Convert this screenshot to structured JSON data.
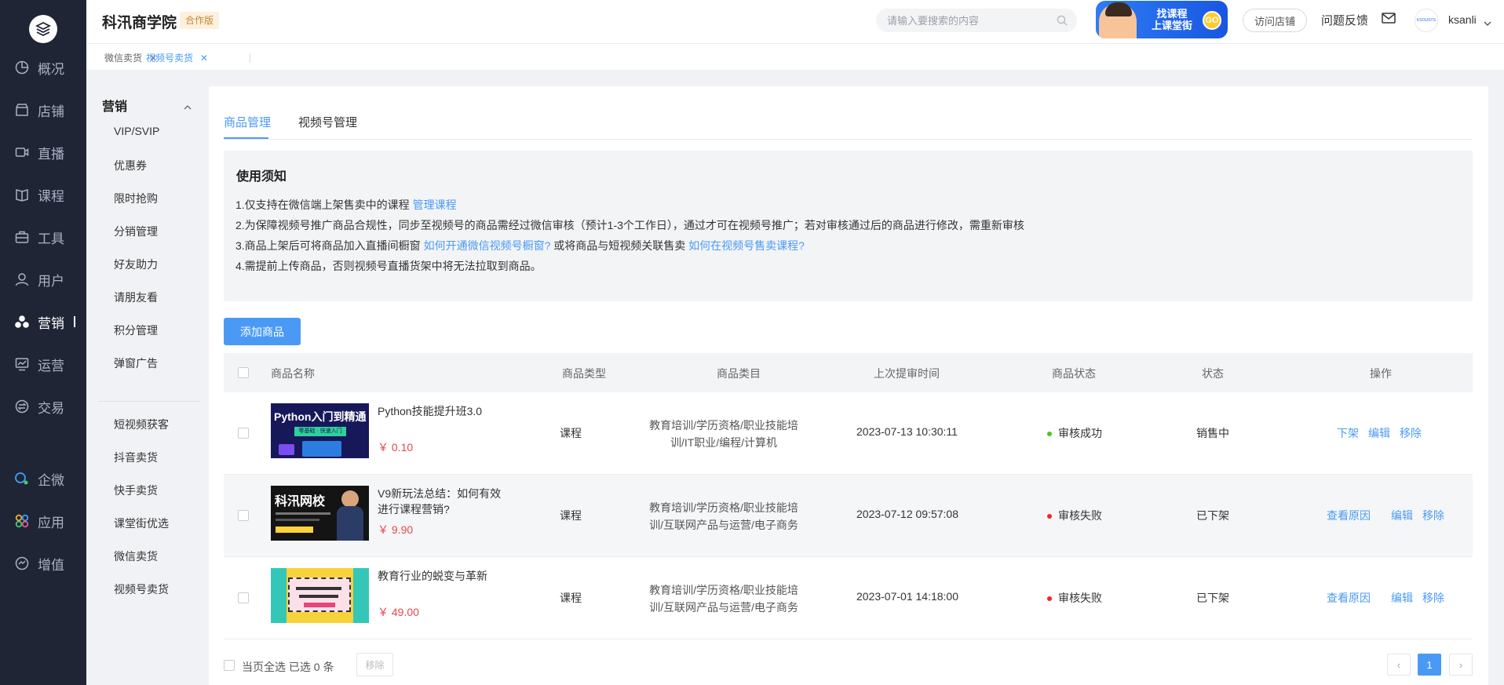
{
  "rail": {
    "items": [
      {
        "label": "概况",
        "icon": "overview-icon"
      },
      {
        "label": "店铺",
        "icon": "store-icon"
      },
      {
        "label": "直播",
        "icon": "live-icon"
      },
      {
        "label": "课程",
        "icon": "course-icon"
      },
      {
        "label": "工具",
        "icon": "toolbox-icon"
      },
      {
        "label": "用户",
        "icon": "user-icon"
      },
      {
        "label": "营销",
        "icon": "marketing-icon"
      },
      {
        "label": "运营",
        "icon": "operation-icon"
      },
      {
        "label": "交易",
        "icon": "trade-icon"
      },
      {
        "label": "企微",
        "icon": "wecom-icon"
      },
      {
        "label": "应用",
        "icon": "apps-icon"
      },
      {
        "label": "增值",
        "icon": "value-added-icon"
      }
    ],
    "active": "营销"
  },
  "header": {
    "brand": "科汛商学院",
    "edition": "合作版",
    "search_placeholder": "请输入要搜索的内容",
    "promo_line1": "找课程",
    "promo_line2": "上课堂街",
    "promo_go": "GO",
    "visit_store": "访问店铺",
    "feedback": "问题反馈",
    "avatar_text": "KSOUSYS",
    "username": "ksanli"
  },
  "tags": [
    {
      "label": "微信卖货",
      "active": false
    },
    {
      "label": "视频号卖货",
      "active": true
    }
  ],
  "submenu": {
    "title": "营销",
    "group1": [
      "VIP/SVIP",
      "优惠券",
      "限时抢购",
      "分销管理",
      "好友助力",
      "请朋友看",
      "积分管理",
      "弹窗广告"
    ],
    "group2": [
      "短视频获客",
      "抖音卖货",
      "快手卖货",
      "课堂街优选",
      "微信卖货",
      "视频号卖货"
    ]
  },
  "tabs": [
    "商品管理",
    "视频号管理"
  ],
  "notice": {
    "title": "使用须知",
    "l1_text": "1.仅支持在微信端上架售卖中的课程 ",
    "l1_link": "管理课程",
    "l2_text": "2.为保障视频号推广商品合规性，同步至视频号的商品需经过微信审核（预计1-3个工作日），通过才可在视频号推广；若对审核通过后的商品进行修改，需重新审核",
    "l3_text_a": "3.商品上架后可将商品加入直播间橱窗 ",
    "l3_link_a": "如何开通微信视频号橱窗?",
    "l3_text_b": " 或将商品与短视频关联售卖 ",
    "l3_link_b": "如何在视频号售卖课程?",
    "l4_text": "4.需提前上传商品，否则视频号直播货架中将无法拉取到商品。"
  },
  "add_button": "添加商品",
  "table": {
    "headers": [
      "商品名称",
      "商品类型",
      "商品类目",
      "上次提审时间",
      "商品状态",
      "状态",
      "操作"
    ],
    "rows": [
      {
        "thumb_title": "Python入门到精通",
        "thumb_sub": "零基础 · 快速入门",
        "name": "Python技能提升班3.0",
        "price": "￥ 0.10",
        "type": "课程",
        "category": "教育培训/学历资格/职业技能培训/IT职业/编程/计算机",
        "time": "2023-07-13 10:30:11",
        "audit": "审核成功",
        "audit_color": "#52c41a",
        "status": "销售中",
        "ops": [
          "下架",
          "编辑",
          "移除"
        ]
      },
      {
        "thumb_title": "科汛网校",
        "thumb_sub": "",
        "name": "V9新玩法总结：如何有效进行课程营销?",
        "price": "￥ 9.90",
        "type": "课程",
        "category": "教育培训/学历资格/职业技能培训/互联网产品与运营/电子商务",
        "time": "2023-07-12 09:57:08",
        "audit": "审核失败",
        "audit_color": "#f5222d",
        "status": "已下架",
        "ops": [
          "查看原因",
          "编辑",
          "移除"
        ]
      },
      {
        "thumb_title": "",
        "thumb_sub": "",
        "name": "教育行业的蜕变与革新",
        "price": "￥ 49.00",
        "type": "课程",
        "category": "教育培训/学历资格/职业技能培训/互联网产品与运营/电子商务",
        "time": "2023-07-01 14:18:00",
        "audit": "审核失败",
        "audit_color": "#f5222d",
        "status": "已下架",
        "ops": [
          "查看原因",
          "编辑",
          "移除"
        ]
      }
    ]
  },
  "footer": {
    "select_all_text": "当页全选 已选 0 条",
    "remove": "移除",
    "page": "1",
    "prev": "‹",
    "next": "›"
  },
  "colors": {
    "accent": "#4a9af5",
    "rail_bg": "#1f2535",
    "price": "#e5484d"
  }
}
